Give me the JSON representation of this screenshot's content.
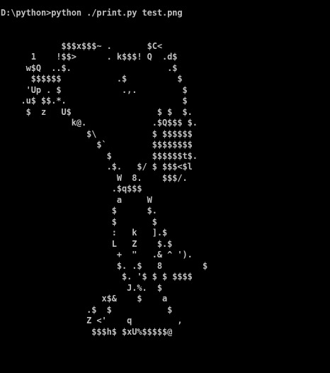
{
  "console": {
    "command_line": "D:\\python>python ./print.py test.png",
    "ascii_art": [
      "",
      "            $$$x$$$~ .       $C<",
      "      1    !$$>      . k$$$! Q  .d$",
      "     w$Q  ..$.                   .$",
      "      $$$$$$           .$          $",
      "     'Up . $            .,.         $",
      "    .u$ $$.*.                       $",
      "     $  z   U$                 $ $  $.",
      "              k@.             .$Q$$$ $.",
      "                 $\\           $ $$$$$$",
      "                   $`         $$$$$$$$",
      "                     $        $$$$$$t$.",
      "                     .$.   $/ $ $$$<$l",
      "                       W  8.    $$$/.",
      "                      .$q$$$",
      "                       a     W",
      "                      $      $.",
      "                      $       $",
      "                      :   k   ].$",
      "                      L   Z    $.$",
      "                       +  \"   .& ^ ').",
      "                       $. .$   8        $",
      "                        $. '$ $ $ $$$$",
      "                         J.%.  $",
      "                    x$&    $    a",
      "                 .$  $           $",
      "                 Z <'    q         ,",
      "                  $$$h$ $xU%$$$$$@"
    ]
  }
}
